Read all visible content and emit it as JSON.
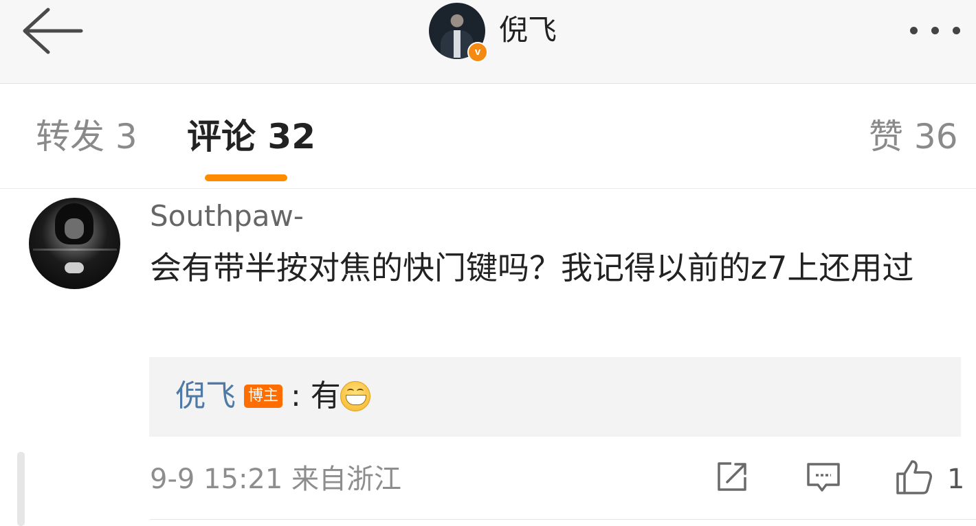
{
  "header": {
    "title": "倪飞",
    "verified_mark": "v",
    "back_icon": "arrow-left-icon",
    "more_icon": "more-dots-icon"
  },
  "tabs": [
    {
      "label": "转发 3",
      "active": false
    },
    {
      "label": "评论 32",
      "active": true
    },
    {
      "label": "赞 36",
      "active": false
    }
  ],
  "comment": {
    "username": "Southpaw-",
    "text": "会有带半按对焦的快门键吗？我记得以前的z7上还用过",
    "reply": {
      "author": "倪飞",
      "badge": "博主",
      "text": ": 有",
      "emoji": "grin-emoji"
    },
    "meta": "9-9 15:21 来自浙江",
    "like_count": "1"
  },
  "colors": {
    "accent": "#ff8c00",
    "link": "#4f7aa5",
    "badge": "#ff6d00",
    "verified": "#f58a13"
  }
}
